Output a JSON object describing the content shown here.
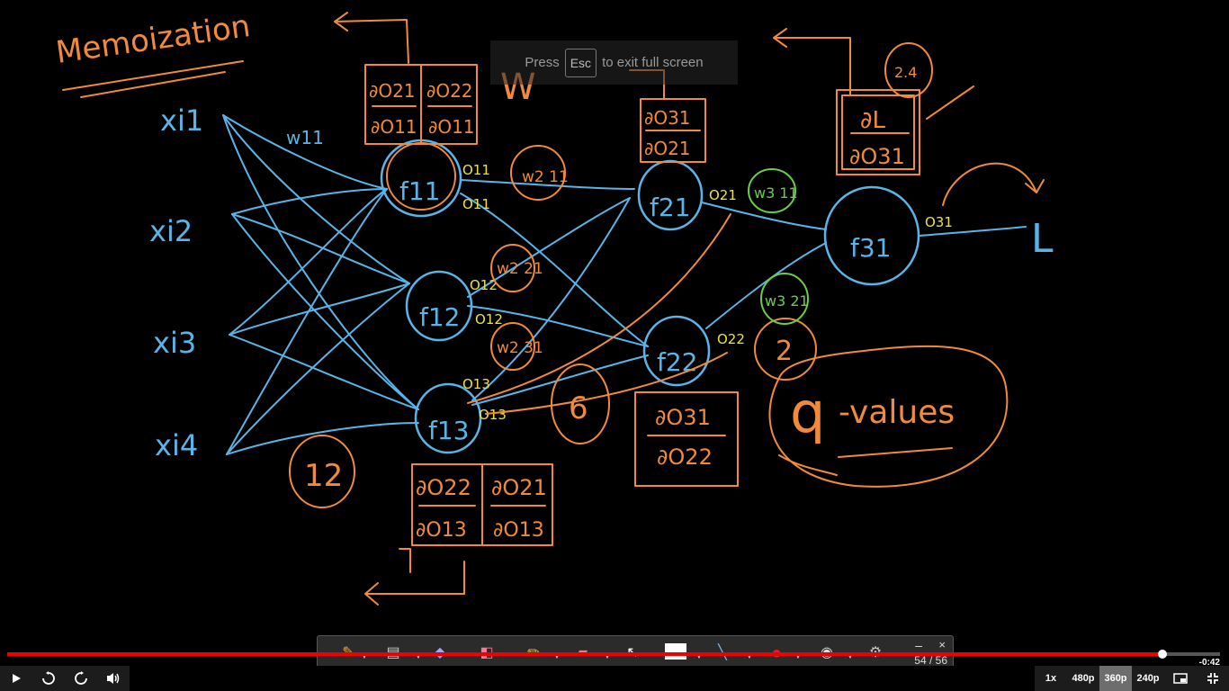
{
  "window": {
    "title": "Memoization"
  },
  "fullscreen_hint": {
    "before": "Press",
    "key": "Esc",
    "after": "to exit full screen"
  },
  "board": {
    "heading": "Memoization",
    "inputs": [
      "xi1",
      "xi2",
      "xi3",
      "xi4"
    ],
    "neurons": [
      "f11",
      "f12",
      "f13",
      "f21",
      "f22",
      "f31"
    ],
    "outputs": [
      "O11",
      "O11",
      "O12",
      "O12",
      "O13",
      "O13",
      "O21",
      "O22",
      "O31"
    ],
    "weights": [
      "w11",
      "w2 11",
      "w2 21",
      "w2 31",
      "w3 11",
      "w3 21",
      "W"
    ],
    "partials": {
      "top_left_num1": "∂O21",
      "top_left_den1": "∂O11",
      "top_left_num2": "∂O22",
      "top_left_den2": "∂O11",
      "mid_top_num": "∂O31",
      "mid_top_den": "∂O21",
      "right_num": "∂L",
      "right_den": "∂O31",
      "mid_bottom_num": "∂O31",
      "mid_bottom_den": "∂O22",
      "bottom_num1": "∂O22",
      "bottom_den1": "∂O13",
      "bottom_num2": "∂O21",
      "bottom_den2": "∂O13"
    },
    "counts": [
      "12",
      "6",
      "2",
      "2.4"
    ],
    "loss": "L",
    "q_label": "q",
    "values_label": "-values"
  },
  "toolbar": {
    "tools": [
      "pen-tool",
      "film-tool",
      "shapes-tool",
      "eraser-tool",
      "pencil-tool",
      "highlighter-tool",
      "pointer-tool",
      "whiteboard-tool",
      "line-tool",
      "color-tool",
      "webcam-tool",
      "settings-tool"
    ],
    "page_count": "54 / 56",
    "minimize": "–",
    "close": "×"
  },
  "player": {
    "progress": 0.9525,
    "time_remaining": "-0:42",
    "speed": "1x",
    "qualities": [
      "480p",
      "360p",
      "240p"
    ],
    "active_quality": "360p"
  }
}
